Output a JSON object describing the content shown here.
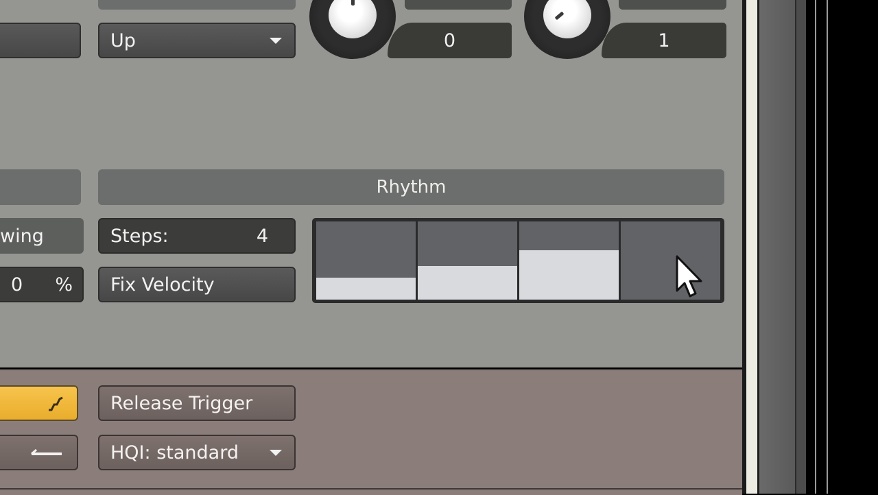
{
  "arp": {
    "direction_dropdown": {
      "value": "Up"
    },
    "knob1": {
      "display_value": "0",
      "rotation_deg": 0
    },
    "knob2": {
      "display_value": "1",
      "rotation_deg": -130
    }
  },
  "rhythm": {
    "header_label": "Rhythm",
    "swing_label": "wing",
    "swing_value": "0",
    "swing_unit": "%",
    "steps_label": "Steps:",
    "steps_value": "4",
    "fix_velocity_label": "Fix Velocity",
    "step_values_percent": [
      28,
      43,
      63,
      0
    ]
  },
  "bottom": {
    "release_trigger_label": "Release Trigger",
    "hqi_dropdown": {
      "value": "HQI: standard"
    },
    "accent_color": "#f2b83a"
  }
}
